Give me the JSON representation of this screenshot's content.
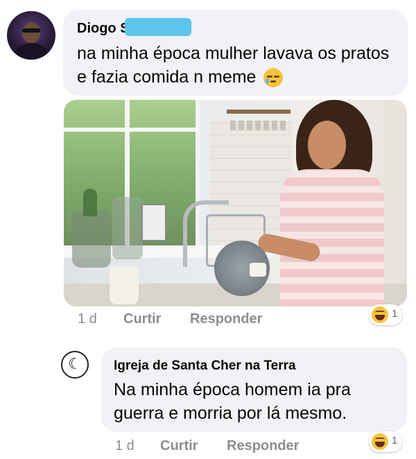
{
  "comments": [
    {
      "author": "Diogo S",
      "text": "na minha época mulher lavava os pratos e fazia comida n meme",
      "trailing_emoji": "sleepy-face-emoji",
      "time": "1 d",
      "like_label": "Curtir",
      "reply_label": "Responder",
      "reaction": {
        "emoji": "laughing-emoji",
        "count": "1"
      }
    },
    {
      "author": "Igreja de Santa Cher na Terra",
      "text": "Na minha época homem ia pra guerra e morria por lá mesmo.",
      "time": "1 d",
      "like_label": "Curtir",
      "reply_label": "Responder",
      "reaction": {
        "emoji": "laughing-emoji",
        "count": "1"
      }
    }
  ],
  "colors": {
    "bubble": "#f0f2f5",
    "meta_text": "#8a8d91",
    "censor_bar": "#5bc6ea",
    "emoji": "#f7c33c"
  }
}
